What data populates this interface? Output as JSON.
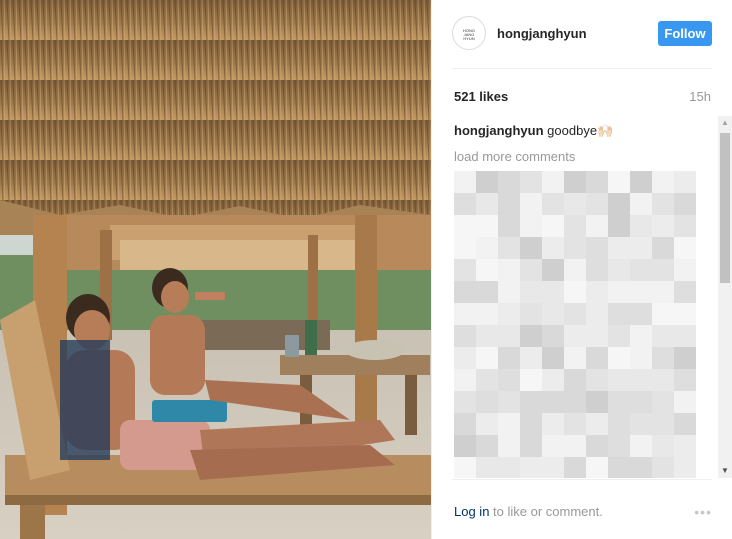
{
  "post": {
    "username": "hongjanghyun",
    "follow_label": "Follow",
    "avatar_text": "HONG JANG HYUN",
    "likes": "521 likes",
    "time": "15h",
    "caption_user": "hongjanghyun",
    "caption_text": "goodbye🙌🏻",
    "load_more": "load more comments",
    "login_text": "Log in",
    "login_suffix": " to like or comment.",
    "more_icon": "•••"
  },
  "colors": {
    "follow_button": "#3897f0",
    "link": "#003569",
    "muted": "#999999"
  }
}
